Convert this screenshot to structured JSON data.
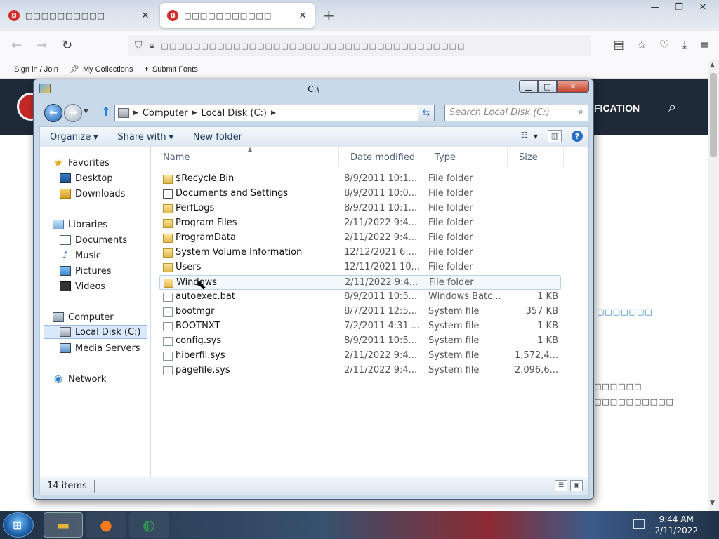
{
  "browser": {
    "tab_inactive_favicon": "B",
    "tab_inactive_title": "□□□□□□□□□□",
    "tab_active_favicon": "B",
    "tab_active_title": "□□□□□□□□□□□",
    "url_text": "□□□□□□□□□□□□□□□□□□□□□□□□□□□□□□□□□□□□□□",
    "bookmarks": [
      "Sign in / Join",
      "My Collections",
      "Submit Fonts"
    ]
  },
  "page": {
    "nav_text": "FICATION",
    "link_text": "□□□□□□□",
    "dark_text_1": "□□□□□□",
    "dark_text_2": "□□□□□□□□□□"
  },
  "explorer": {
    "title": "C:\\",
    "breadcrumb": [
      "Computer",
      "Local Disk (C:)"
    ],
    "search_placeholder": "Search Local Disk (C:)",
    "toolbar": {
      "organize": "Organize",
      "share_with": "Share with",
      "new_folder": "New folder"
    },
    "nav_pane": {
      "favorites": "Favorites",
      "desktop": "Desktop",
      "downloads": "Downloads",
      "libraries": "Libraries",
      "documents": "Documents",
      "music": "Music",
      "pictures": "Pictures",
      "videos": "Videos",
      "computer": "Computer",
      "local_disk": "Local Disk (C:)",
      "media_servers": "Media Servers",
      "network": "Network"
    },
    "columns": {
      "name": "Name",
      "date": "Date modified",
      "type": "Type",
      "size": "Size"
    },
    "files": [
      {
        "icon": "folder",
        "name": "$Recycle.Bin",
        "date": "8/9/2011 10:1...",
        "type": "File folder",
        "size": ""
      },
      {
        "icon": "shortcut",
        "name": "Documents and Settings",
        "date": "8/9/2011 10:0...",
        "type": "File folder",
        "size": ""
      },
      {
        "icon": "folder",
        "name": "PerfLogs",
        "date": "8/9/2011 10:1...",
        "type": "File folder",
        "size": ""
      },
      {
        "icon": "folder",
        "name": "Program Files",
        "date": "2/11/2022 9:4...",
        "type": "File folder",
        "size": ""
      },
      {
        "icon": "folder",
        "name": "ProgramData",
        "date": "2/11/2022 9:4...",
        "type": "File folder",
        "size": ""
      },
      {
        "icon": "folder",
        "name": "System Volume Information",
        "date": "12/12/2021 6:...",
        "type": "File folder",
        "size": ""
      },
      {
        "icon": "folder",
        "name": "Users",
        "date": "12/11/2021 10...",
        "type": "File folder",
        "size": ""
      },
      {
        "icon": "folder",
        "name": "Windows",
        "date": "2/11/2022 9:4...",
        "type": "File folder",
        "size": ""
      },
      {
        "icon": "file",
        "name": "autoexec.bat",
        "date": "8/9/2011 10:5...",
        "type": "Windows Batc...",
        "size": "1 KB"
      },
      {
        "icon": "file",
        "name": "bootmgr",
        "date": "8/7/2011 12:5...",
        "type": "System file",
        "size": "357 KB"
      },
      {
        "icon": "file",
        "name": "BOOTNXT",
        "date": "7/2/2011 4:31 ...",
        "type": "System file",
        "size": "1 KB"
      },
      {
        "icon": "file",
        "name": "config.sys",
        "date": "8/9/2011 10:5...",
        "type": "System file",
        "size": "1 KB"
      },
      {
        "icon": "file",
        "name": "hiberfil.sys",
        "date": "2/11/2022 9:4...",
        "type": "System file",
        "size": "1,572,4..."
      },
      {
        "icon": "file",
        "name": "pagefile.sys",
        "date": "2/11/2022 9:4...",
        "type": "System file",
        "size": "2,096,6..."
      }
    ],
    "hover_index": 7,
    "status": "14 items"
  },
  "taskbar": {
    "time": "9:44 AM",
    "date": "2/11/2022"
  },
  "colors": {
    "page_header": "#1f2a38",
    "window_frame": "#c8d9ea",
    "link": "#1e7fc2"
  }
}
